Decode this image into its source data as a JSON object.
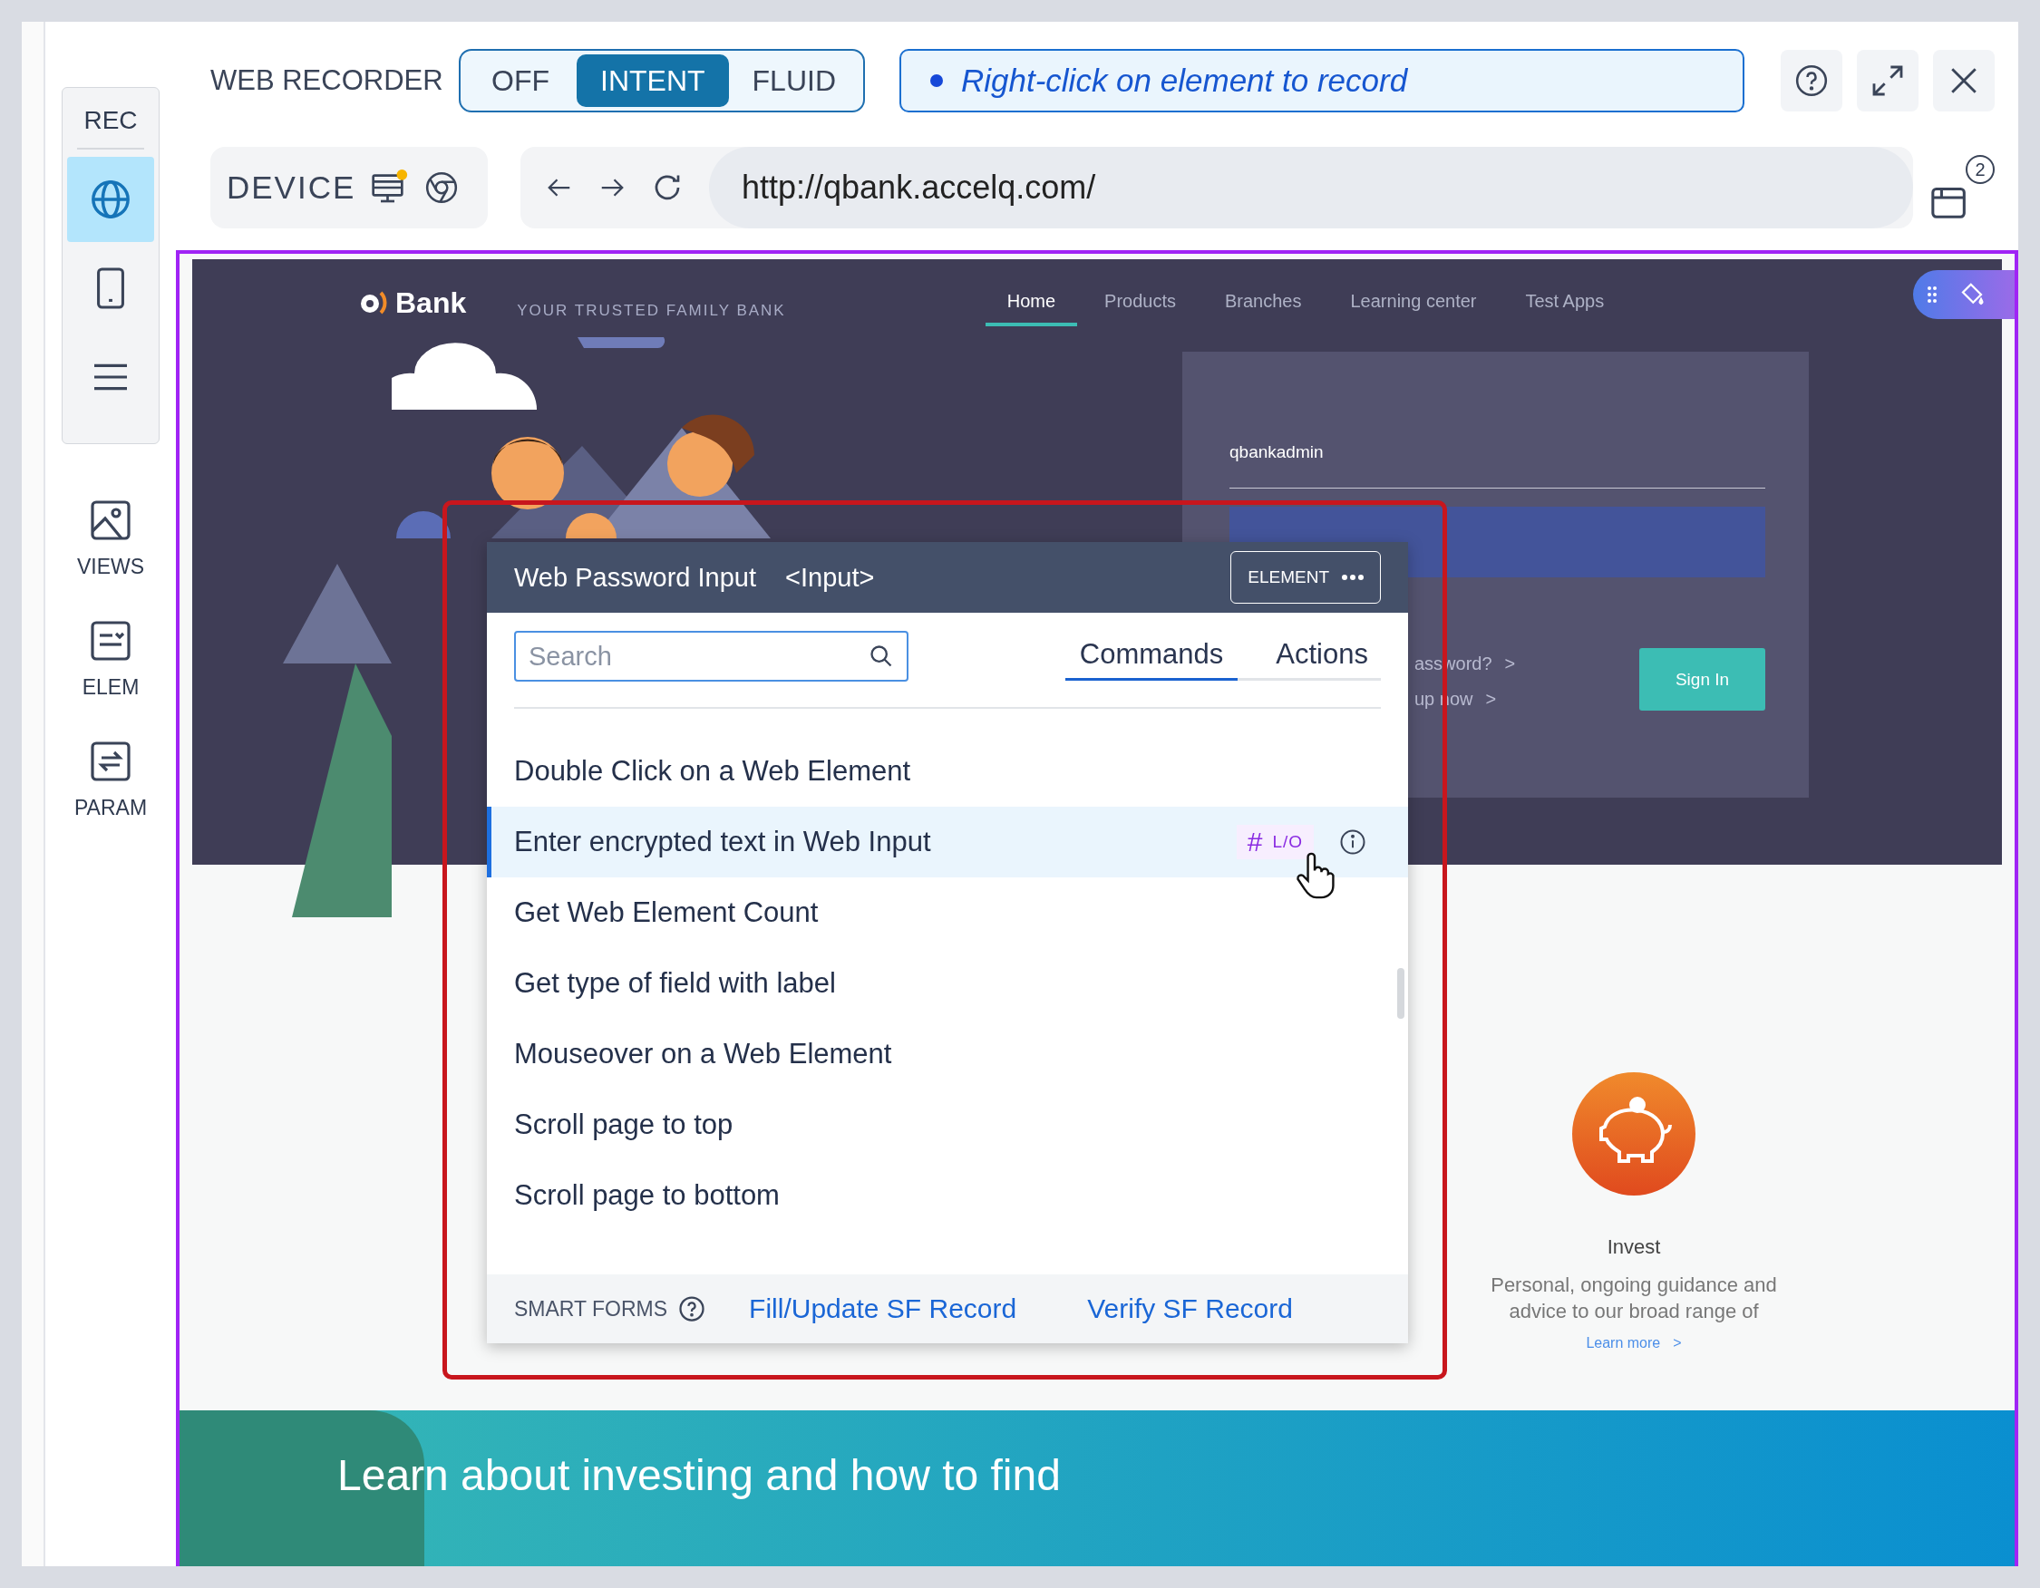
{
  "sidebar": {
    "rec_label": "REC",
    "modes": [
      {
        "kind": "globe",
        "selected": true
      },
      {
        "kind": "tablet",
        "selected": false
      },
      {
        "kind": "menu",
        "selected": false
      }
    ],
    "tools": [
      {
        "kind": "image",
        "label": "VIEWS"
      },
      {
        "kind": "element",
        "label": "ELEM"
      },
      {
        "kind": "param",
        "label": "PARAM"
      }
    ]
  },
  "recorder": {
    "title": "WEB RECORDER",
    "modes": [
      {
        "label": "OFF",
        "selected": false
      },
      {
        "label": "INTENT",
        "selected": true
      },
      {
        "label": "FLUID",
        "selected": false
      }
    ],
    "hint": "Right-click on element to record"
  },
  "device": {
    "label": "DEVICE",
    "notification": true
  },
  "address": {
    "url": "http://qbank.accelq.com/"
  },
  "clipboard_badge": "2",
  "site": {
    "brand": "Bank",
    "tagline": "YOUR TRUSTED FAMILY BANK",
    "nav": [
      {
        "label": "Home",
        "selected": true
      },
      {
        "label": "Products",
        "selected": false
      },
      {
        "label": "Branches",
        "selected": false
      },
      {
        "label": "Learning center",
        "selected": false
      },
      {
        "label": "Test Apps",
        "selected": false
      }
    ],
    "login": {
      "username": "qbankadmin",
      "links": [
        {
          "label": "assword?",
          "chevron": ">"
        },
        {
          "label": "up now",
          "chevron": ">"
        }
      ],
      "button": "Sign In"
    },
    "invest": {
      "title": "Invest",
      "text": "Personal, ongoing guidance and advice to our broad range of",
      "link": "Learn more",
      "chevron": ">"
    },
    "banner": "Learn about investing and how to find"
  },
  "popup": {
    "title": "Web Password Input",
    "tag": "<Input>",
    "type_button": "ELEMENT",
    "search_placeholder": "Search",
    "tabs": [
      {
        "label": "Commands",
        "selected": true
      },
      {
        "label": "Actions",
        "selected": false
      }
    ],
    "commands": [
      {
        "label": "Double Click on a Web Element",
        "selected": false
      },
      {
        "label": "Enter encrypted text in Web Input",
        "selected": true,
        "tag_symbol": "#",
        "tag": "L/O"
      },
      {
        "label": "Get Web Element Count",
        "selected": false
      },
      {
        "label": "Get type of field with label",
        "selected": false
      },
      {
        "label": "Mouseover on a Web Element",
        "selected": false
      },
      {
        "label": "Scroll page to top",
        "selected": false
      },
      {
        "label": "Scroll page to bottom",
        "selected": false
      }
    ],
    "footer": {
      "label": "SMART FORMS",
      "links": [
        "Fill/Update SF Record",
        "Verify SF Record"
      ]
    }
  }
}
